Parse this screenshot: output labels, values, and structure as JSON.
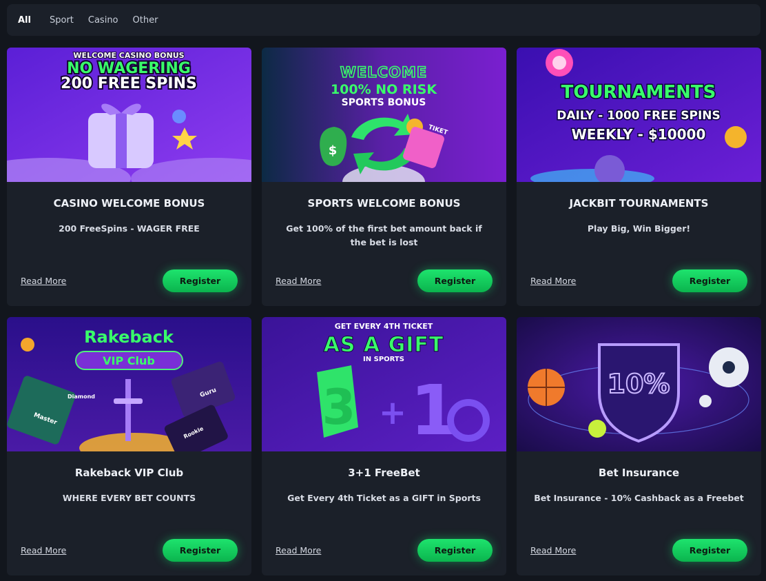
{
  "filters": {
    "tabs": [
      {
        "label": "All",
        "active": true
      },
      {
        "label": "Sport",
        "active": false
      },
      {
        "label": "Casino",
        "active": false
      },
      {
        "label": "Other",
        "active": false
      }
    ]
  },
  "colors": {
    "page_bg": "#12161d",
    "card_bg": "#1b2029",
    "accent_green": "#17d466",
    "neon_green": "#39ff6a"
  },
  "promotions": [
    {
      "banner_lines": [
        "WELCOME CASINO BONUS",
        "NO WAGERING",
        "200 FREE SPINS"
      ],
      "title": "CASINO WELCOME BONUS",
      "subtitle": "200 FreeSpins - WAGER FREE",
      "read_more": "Read More",
      "register": "Register"
    },
    {
      "banner_lines": [
        "WELCOME",
        "100% NO RISK",
        "SPORTS BONUS",
        "TIKET"
      ],
      "title": "SPORTS WELCOME BONUS",
      "subtitle": "Get 100% of the first bet amount back if the bet is lost",
      "read_more": "Read More",
      "register": "Register"
    },
    {
      "banner_lines": [
        "TOURNAMENTS",
        "DAILY - 1000 FREE SPINS",
        "WEEKLY - $10000"
      ],
      "title": "JACKBIT TOURNAMENTS",
      "subtitle": "Play Big, Win Bigger!",
      "read_more": "Read More",
      "register": "Register"
    },
    {
      "banner_lines": [
        "Rakeback",
        "VIP Club",
        "Master",
        "Guru",
        "Diamond",
        "Rookie"
      ],
      "title": "Rakeback VIP Club",
      "subtitle": "WHERE EVERY BET COUNTS",
      "read_more": "Read More",
      "register": "Register"
    },
    {
      "banner_lines": [
        "GET EVERY 4TH TICKET",
        "AS A GIFT",
        "IN SPORTS"
      ],
      "title": "3+1 FreeBet",
      "subtitle": "Get Every 4th Ticket as a GIFT in Sports",
      "read_more": "Read More",
      "register": "Register"
    },
    {
      "banner_lines": [
        "10%"
      ],
      "title": "Bet Insurance",
      "subtitle": "Bet Insurance - 10% Cashback as a Freebet",
      "read_more": "Read More",
      "register": "Register"
    }
  ]
}
